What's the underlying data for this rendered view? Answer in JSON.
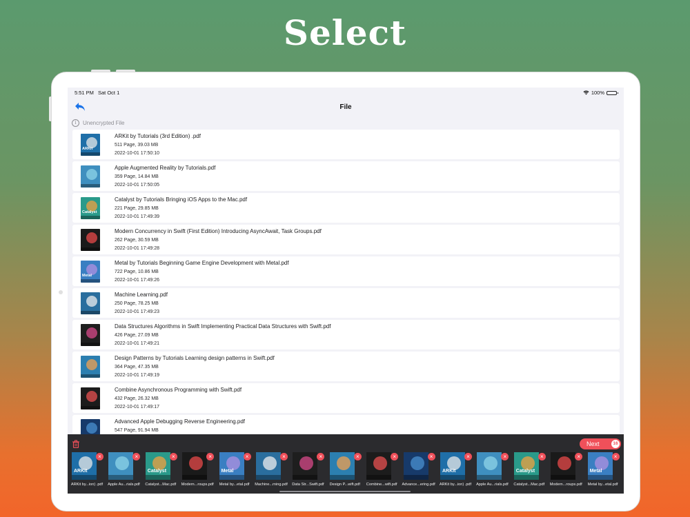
{
  "headline": "Select",
  "colors": {
    "accent_red": "#f0505a",
    "link_blue": "#1a73e8",
    "tray_bg": "#2b2b2e"
  },
  "status_bar": {
    "time": "5:51 PM",
    "date": "Sat Oct 1",
    "battery": "100%",
    "icons": [
      "wifi-icon",
      "battery-icon"
    ]
  },
  "nav": {
    "title": "File",
    "back_icon": "back-arrow-icon"
  },
  "section": {
    "label": "Unencrypted File",
    "icon": "info-icon"
  },
  "files": [
    {
      "name": "ARKit by Tutorials (3rd Edition) .pdf",
      "meta": "511 Page, 39.03 MB",
      "date": "2022-10-01 17:50:10",
      "cover_title": "ARKit",
      "cover_color": "#1f6fa8",
      "cover_accent": "#e8e8e8"
    },
    {
      "name": "Apple Augmented Reality by Tutorials.pdf",
      "meta": "359 Page, 14.84 MB",
      "date": "2022-10-01 17:50:05",
      "cover_title": "",
      "cover_color": "#3f8fbf",
      "cover_accent": "#8fd4e8"
    },
    {
      "name": "Catalyst by Tutorials Bringing iOS Apps to the Mac.pdf",
      "meta": "221 Page, 29.85 MB",
      "date": "2022-10-01 17:49:39",
      "cover_title": "Catalyst",
      "cover_color": "#2a9a8a",
      "cover_accent": "#f0a040"
    },
    {
      "name": "Modern Concurrency in Swift (First Edition) Introducing AsyncAwait, Task Groups.pdf",
      "meta": "262 Page, 30.59 MB",
      "date": "2022-10-01 17:49:28",
      "cover_title": "",
      "cover_color": "#1a1a1a",
      "cover_accent": "#e84a4a"
    },
    {
      "name": "Metal by Tutorials Beginning Game Engine Development with Metal.pdf",
      "meta": "722 Page, 10.86 MB",
      "date": "2022-10-01 17:49:26",
      "cover_title": "Metal",
      "cover_color": "#3a7fc2",
      "cover_accent": "#b090e0"
    },
    {
      "name": "Machine Learning.pdf",
      "meta": "250 Page, 78.25 MB",
      "date": "2022-10-01 17:49:23",
      "cover_title": "",
      "cover_color": "#2a6e9e",
      "cover_accent": "#eeeeee"
    },
    {
      "name": "Data Structures  Algorithms in Swift Implementing Practical Data Structures with Swift.pdf",
      "meta": "426 Page, 27.09 MB",
      "date": "2022-10-01 17:49:21",
      "cover_title": "",
      "cover_color": "#1e1e1e",
      "cover_accent": "#d84a8a"
    },
    {
      "name": "Design Patterns by Tutorials Learning design patterns in Swift.pdf",
      "meta": "364 Page, 47.35 MB",
      "date": "2022-10-01 17:49:19",
      "cover_title": "",
      "cover_color": "#2c7fb0",
      "cover_accent": "#f0a050"
    },
    {
      "name": "Combine Asynchronous Programming with Swift.pdf",
      "meta": "432 Page, 26.32 MB",
      "date": "2022-10-01 17:49:17",
      "cover_title": "",
      "cover_color": "#1c1c1c",
      "cover_accent": "#e85050"
    },
    {
      "name": "Advanced Apple Debugging  Reverse Engineering.pdf",
      "meta": "547 Page, 91.94 MB",
      "date": "",
      "cover_title": "",
      "cover_color": "#173a6a",
      "cover_accent": "#4a90d0"
    }
  ],
  "tray": {
    "next_label": "Next",
    "count": "16",
    "trash_icon": "trash-icon",
    "remove_icon": "close-icon",
    "remove_glyph": "×",
    "selected": [
      {
        "name": "ARKit by...ion) .pdf",
        "cover_title": "ARKit",
        "cover_color": "#1f6fa8",
        "cover_accent": "#e8e8e8"
      },
      {
        "name": "Apple Au...rials.pdf",
        "cover_title": "",
        "cover_color": "#3f8fbf",
        "cover_accent": "#8fd4e8"
      },
      {
        "name": "Catalyst...Mac.pdf",
        "cover_title": "Catalyst",
        "cover_color": "#2a9a8a",
        "cover_accent": "#f0a040"
      },
      {
        "name": "Modern...roups.pdf",
        "cover_title": "",
        "cover_color": "#1a1a1a",
        "cover_accent": "#e84a4a"
      },
      {
        "name": "Metal by...etal.pdf",
        "cover_title": "Metal",
        "cover_color": "#3a7fc2",
        "cover_accent": "#b090e0"
      },
      {
        "name": "Machine...rning.pdf",
        "cover_title": "",
        "cover_color": "#2a6e9e",
        "cover_accent": "#eeeeee"
      },
      {
        "name": "Data Str...Swift.pdf",
        "cover_title": "",
        "cover_color": "#1e1e1e",
        "cover_accent": "#d84a8a"
      },
      {
        "name": "Design P...wift.pdf",
        "cover_title": "",
        "cover_color": "#2c7fb0",
        "cover_accent": "#f0a050"
      },
      {
        "name": "Combine...wift.pdf",
        "cover_title": "",
        "cover_color": "#1c1c1c",
        "cover_accent": "#e85050"
      },
      {
        "name": "Advance...ering.pdf",
        "cover_title": "",
        "cover_color": "#173a6a",
        "cover_accent": "#4a90d0"
      },
      {
        "name": "ARKit by...ion) .pdf",
        "cover_title": "ARKit",
        "cover_color": "#1f6fa8",
        "cover_accent": "#e8e8e8"
      },
      {
        "name": "Apple Au...rials.pdf",
        "cover_title": "",
        "cover_color": "#3f8fbf",
        "cover_accent": "#8fd4e8"
      },
      {
        "name": "Catalyst...Mac.pdf",
        "cover_title": "Catalyst",
        "cover_color": "#2a9a8a",
        "cover_accent": "#f0a040"
      },
      {
        "name": "Modern...roups.pdf",
        "cover_title": "",
        "cover_color": "#1a1a1a",
        "cover_accent": "#e84a4a"
      },
      {
        "name": "Metal by...etal.pdf",
        "cover_title": "Metal",
        "cover_color": "#3a7fc2",
        "cover_accent": "#b090e0"
      }
    ]
  }
}
